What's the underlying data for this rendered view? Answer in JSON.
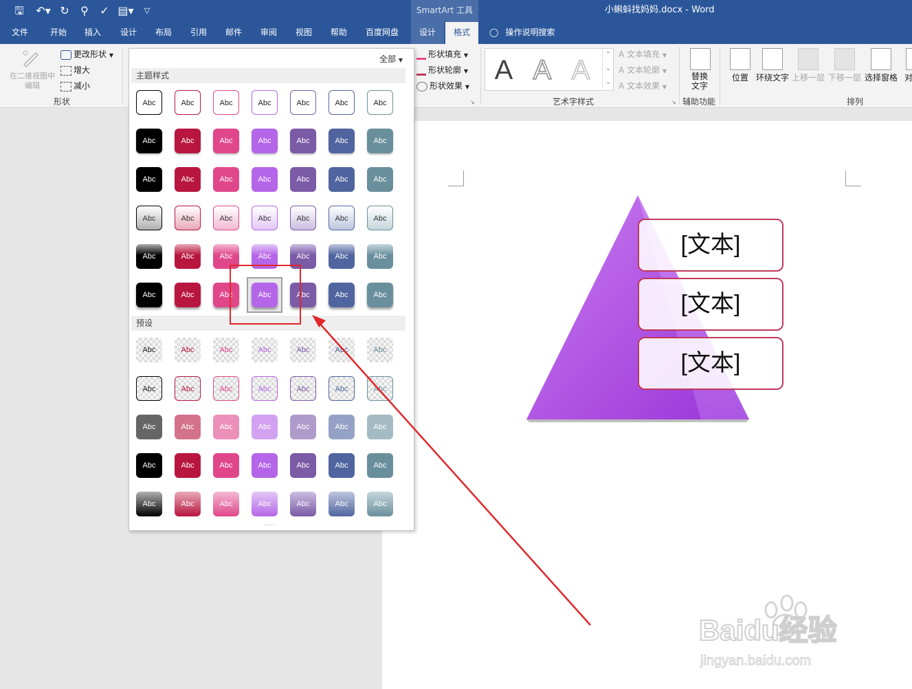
{
  "titlebar": {
    "document_title": "小蝌蚪找妈妈.docx  -  Word",
    "context_tool": "SmartArt 工具"
  },
  "tabs": [
    "文件",
    "开始",
    "插入",
    "设计",
    "布局",
    "引用",
    "邮件",
    "审阅",
    "视图",
    "帮助",
    "百度网盘",
    "设计",
    "格式"
  ],
  "active_tab": "格式",
  "tell_me": "操作说明搜索",
  "ribbon": {
    "shape_group": {
      "edit_in_2d": "在二维视图中\n编辑",
      "change_shape": "更改形状",
      "larger": "增大",
      "smaller": "减小",
      "label": "形状"
    },
    "shape_style": {
      "fill": "形状填充",
      "outline": "形状轮廓",
      "effects": "形状效果"
    },
    "wordart": {
      "letter": "A",
      "text_fill": "文本填充",
      "text_outline": "文本轮廓",
      "text_effects": "文本效果",
      "label": "艺术字样式"
    },
    "accessibility": {
      "alt_text": "替换\n文字",
      "label": "辅助功能"
    },
    "arrange": {
      "position": "位置",
      "wrap_text": "环绕文字",
      "bring_forward": "上移一层",
      "send_backward": "下移一层",
      "selection_pane": "选择窗格",
      "align": "对",
      "label": "排列"
    }
  },
  "gallery": {
    "filter": "全部",
    "theme_header": "主题样式",
    "preset_header": "预设",
    "swatch_label": "Abc",
    "selected": {
      "section": "theme",
      "row": 5,
      "col": 3
    }
  },
  "colors": {
    "accent": "#2b579a",
    "theme": [
      "#000000",
      "#b8163f",
      "#e0478b",
      "#b566e8",
      "#7b5aa6",
      "#50659f",
      "#6a8f9c"
    ]
  },
  "document": {
    "smartart_boxes": [
      "[文本]",
      "[文本]",
      "[文本]"
    ]
  },
  "watermark": {
    "brand": "Baidu经验",
    "url": "jingyan.baidu.com"
  }
}
